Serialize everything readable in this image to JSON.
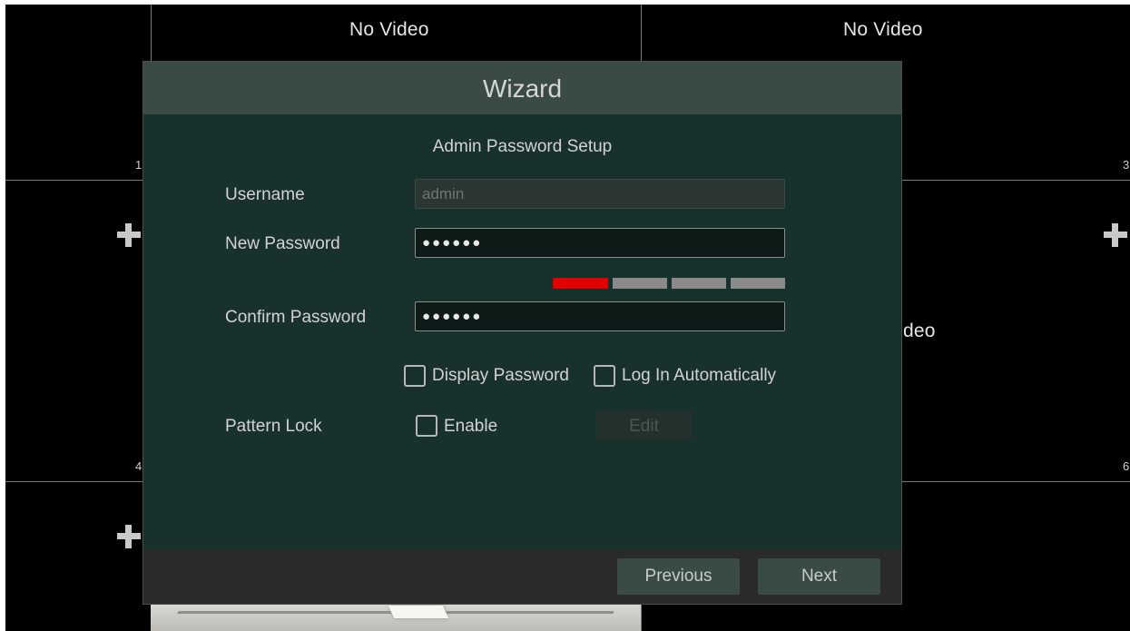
{
  "video_grid": {
    "no_video_label_1": "No Video",
    "no_video_label_2": "No Video",
    "partial_label": "deo",
    "channel_numbers": [
      "1",
      "3",
      "4",
      "6"
    ]
  },
  "dialog": {
    "title": "Wizard",
    "section_title": "Admin Password Setup",
    "username": {
      "label": "Username",
      "value": "admin",
      "disabled": true
    },
    "new_password": {
      "label": "New Password",
      "value": "●●●●●●"
    },
    "password_strength": {
      "level": 1,
      "of": 4,
      "colors": {
        "active": "#e00000",
        "inactive": "#8a8a8a"
      }
    },
    "confirm_password": {
      "label": "Confirm Password",
      "value": "●●●●●●"
    },
    "display_password": {
      "label": "Display Password",
      "checked": false
    },
    "log_in_automatically": {
      "label": "Log In Automatically",
      "checked": false
    },
    "pattern_lock": {
      "label": "Pattern Lock",
      "enable_label": "Enable",
      "enabled": false,
      "edit_label": "Edit"
    },
    "buttons": {
      "previous": "Previous",
      "next": "Next"
    }
  }
}
